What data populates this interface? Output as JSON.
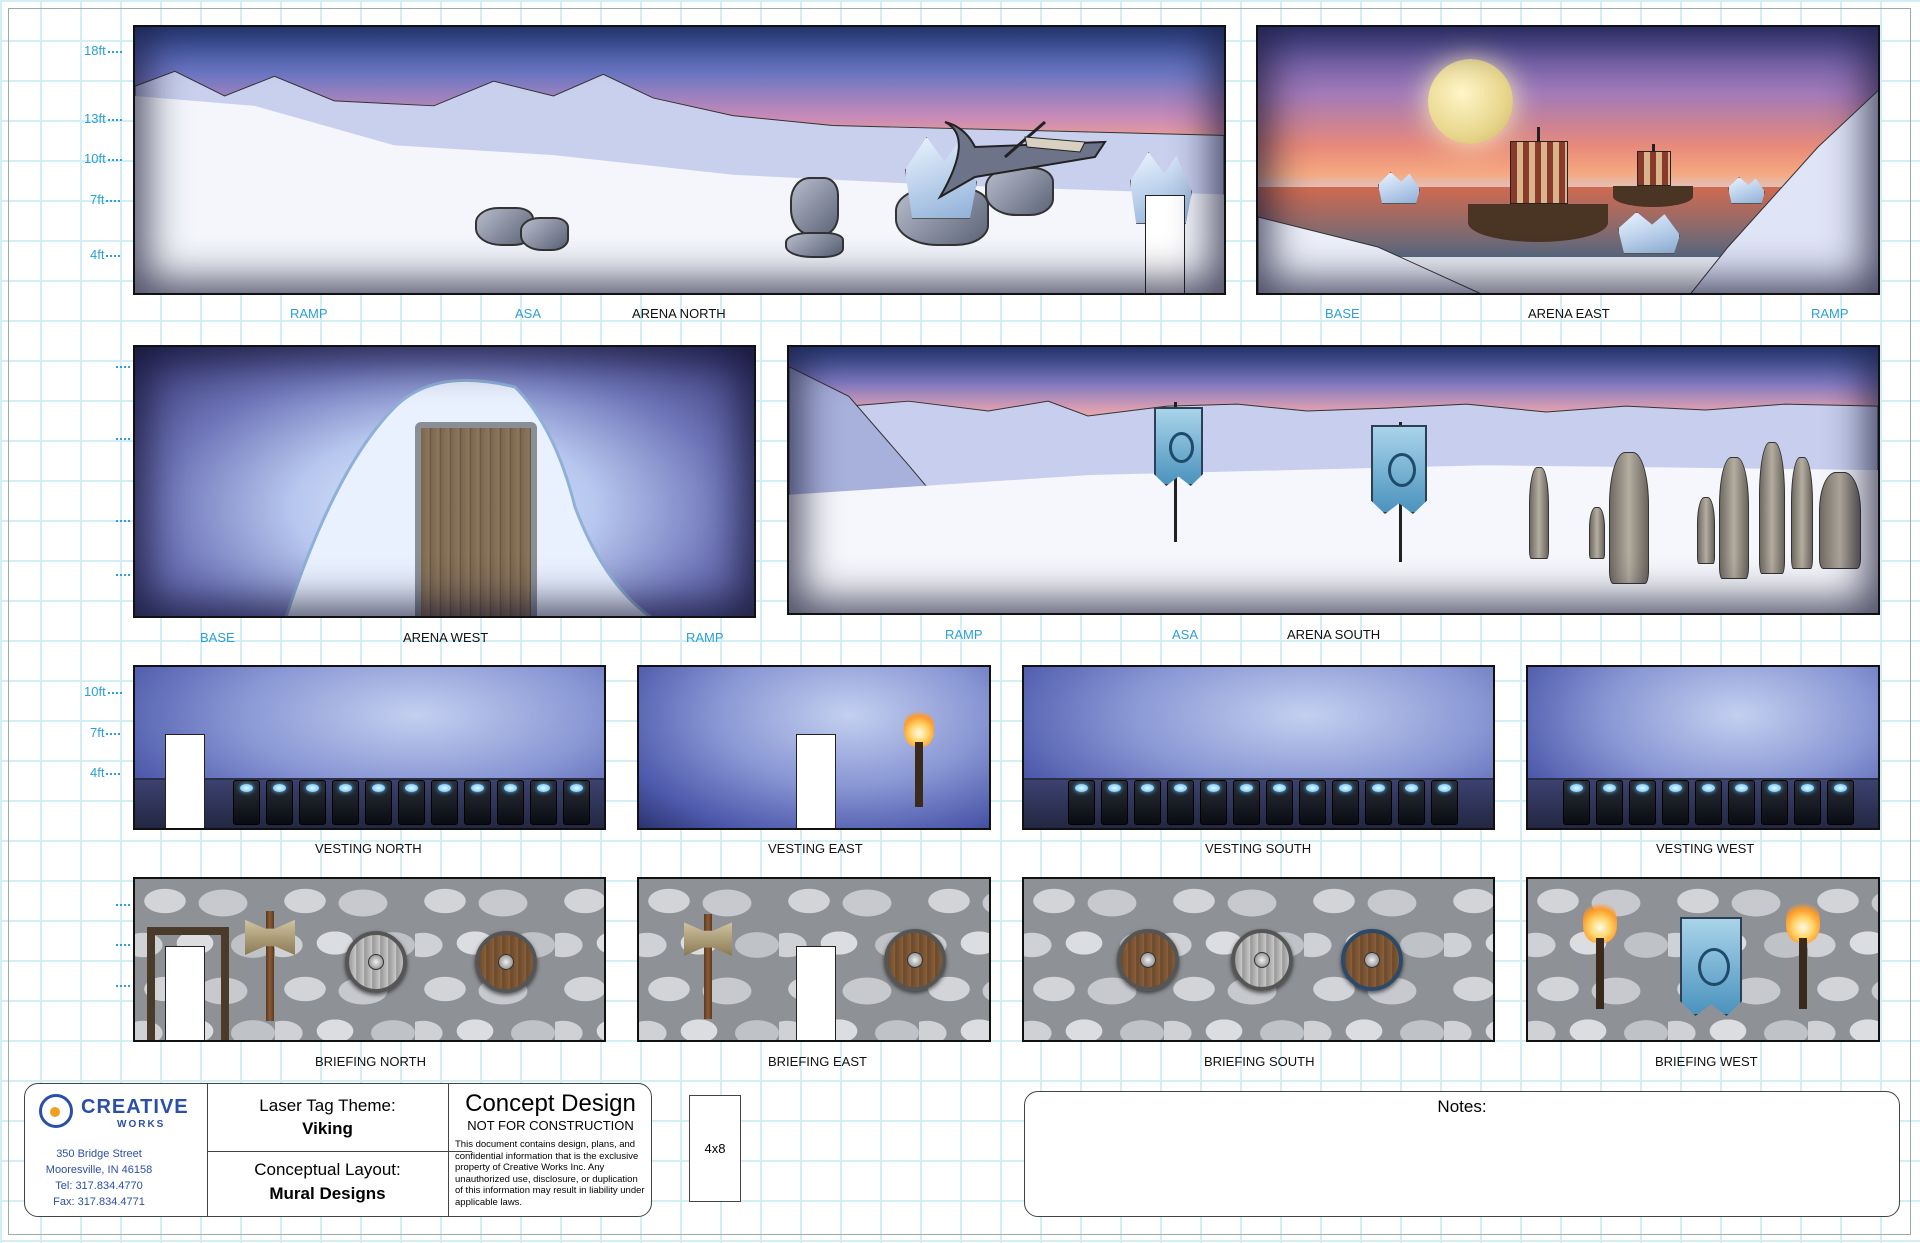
{
  "height_scale": {
    "top": [
      "18ft",
      "13ft",
      "10ft",
      "7ft",
      "4ft"
    ],
    "bottom": [
      "10ft",
      "7ft",
      "4ft"
    ]
  },
  "panels": {
    "arena_north": {
      "caption": "ARENA NORTH",
      "zones": [
        "RAMP",
        "ASA"
      ]
    },
    "arena_east": {
      "caption": "ARENA EAST",
      "zones": [
        "BASE",
        "RAMP"
      ]
    },
    "arena_west": {
      "caption": "ARENA WEST",
      "zones": [
        "BASE",
        "RAMP"
      ]
    },
    "arena_south": {
      "caption": "ARENA SOUTH",
      "zones": [
        "RAMP",
        "ASA"
      ]
    },
    "vesting": [
      "VESTING NORTH",
      "VESTING EAST",
      "VESTING SOUTH",
      "VESTING WEST"
    ],
    "briefing": [
      "BRIEFING NORTH",
      "BRIEFING EAST",
      "BRIEFING SOUTH",
      "BRIEFING WEST"
    ]
  },
  "title_block": {
    "logo_main": "CREATIVE",
    "logo_sub": "WORKS",
    "address": [
      "350 Bridge Street",
      "Mooresville, IN 46158",
      "Tel: 317.834.4770",
      "Fax: 317.834.4771"
    ],
    "theme_label": "Laser Tag Theme:",
    "theme_value": "Viking",
    "layout_label": "Conceptual Layout:",
    "layout_value": "Mural Designs",
    "concept_title": "Concept Design",
    "concept_sub": "NOT FOR CONSTRUCTION",
    "disclaimer": "This document contains design, plans, and confidential information that is the exclusive property of Creative Works Inc.  Any unauthorized use, disclosure, or duplication of this information may result in liability under applicable laws.",
    "sheet_size": "4x8",
    "notes_label": "Notes:"
  },
  "colors": {
    "accent_blue": "#2a9fd8",
    "grid": "#d4eef5"
  }
}
